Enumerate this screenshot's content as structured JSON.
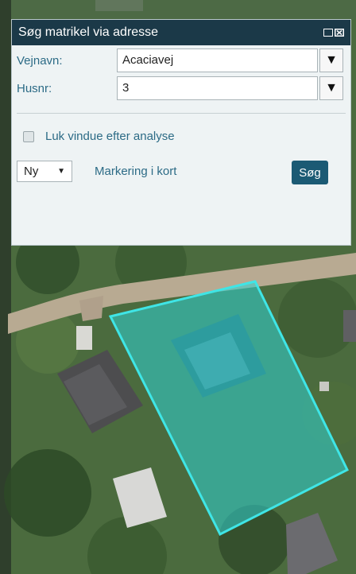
{
  "panel": {
    "title": "Søg matrikel via adresse",
    "street_label": "Vejnavn:",
    "street_value": "Acaciavej",
    "house_label": "Husnr:",
    "house_value": "3",
    "checkbox_label": "Luk vindue efter analyse",
    "mode_value": "Ny",
    "mark_link": "Markering i kort",
    "search_button": "Søg"
  },
  "colors": {
    "titlebar": "#1b3948",
    "label_text": "#2c6b86",
    "highlight": "#3fe5e6"
  },
  "icons": {
    "minimize": "minimize-icon",
    "close": "close-icon",
    "dropdown": "dropdown-arrow-icon"
  }
}
